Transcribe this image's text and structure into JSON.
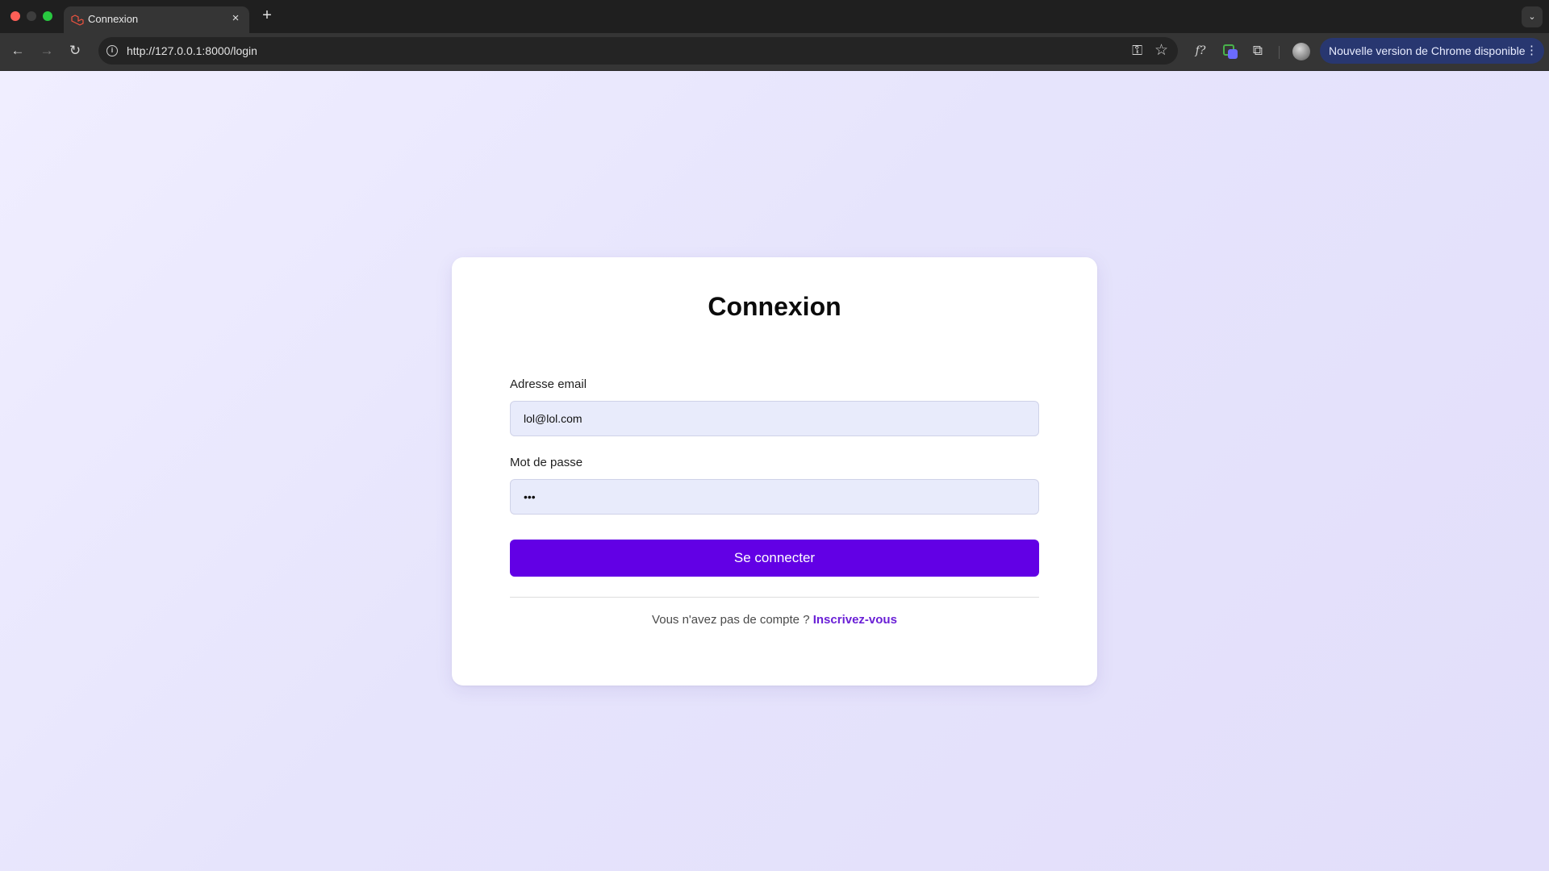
{
  "browser": {
    "tab_title": "Connexion",
    "tab_close": "×",
    "new_tab": "+",
    "url": "http://127.0.0.1:8000/login",
    "update_label": "Nouvelle version de Chrome disponible",
    "icons": {
      "close": "×",
      "back": "←",
      "forward": "→",
      "reload": "↻",
      "info": "i",
      "key": "⚿",
      "star": "☆",
      "fx": "f?",
      "puzzle": "⧉",
      "more": "⋮",
      "tab_list": "⌄"
    },
    "colors": {
      "update_pill": "#283770",
      "traffic_close": "#ff5f57",
      "traffic_max": "#28c840"
    }
  },
  "login": {
    "title": "Connexion",
    "email_label": "Adresse email",
    "email_value": "lol@lol.com",
    "password_label": "Mot de passe",
    "password_value": "•••",
    "submit_label": "Se connecter",
    "signup_prompt": "Vous n'avez pas de compte ?",
    "signup_link": "Inscrivez-vous",
    "colors": {
      "accent": "#6200e5",
      "input_bg": "#e8ebfb",
      "link": "#6a1fd6"
    }
  }
}
